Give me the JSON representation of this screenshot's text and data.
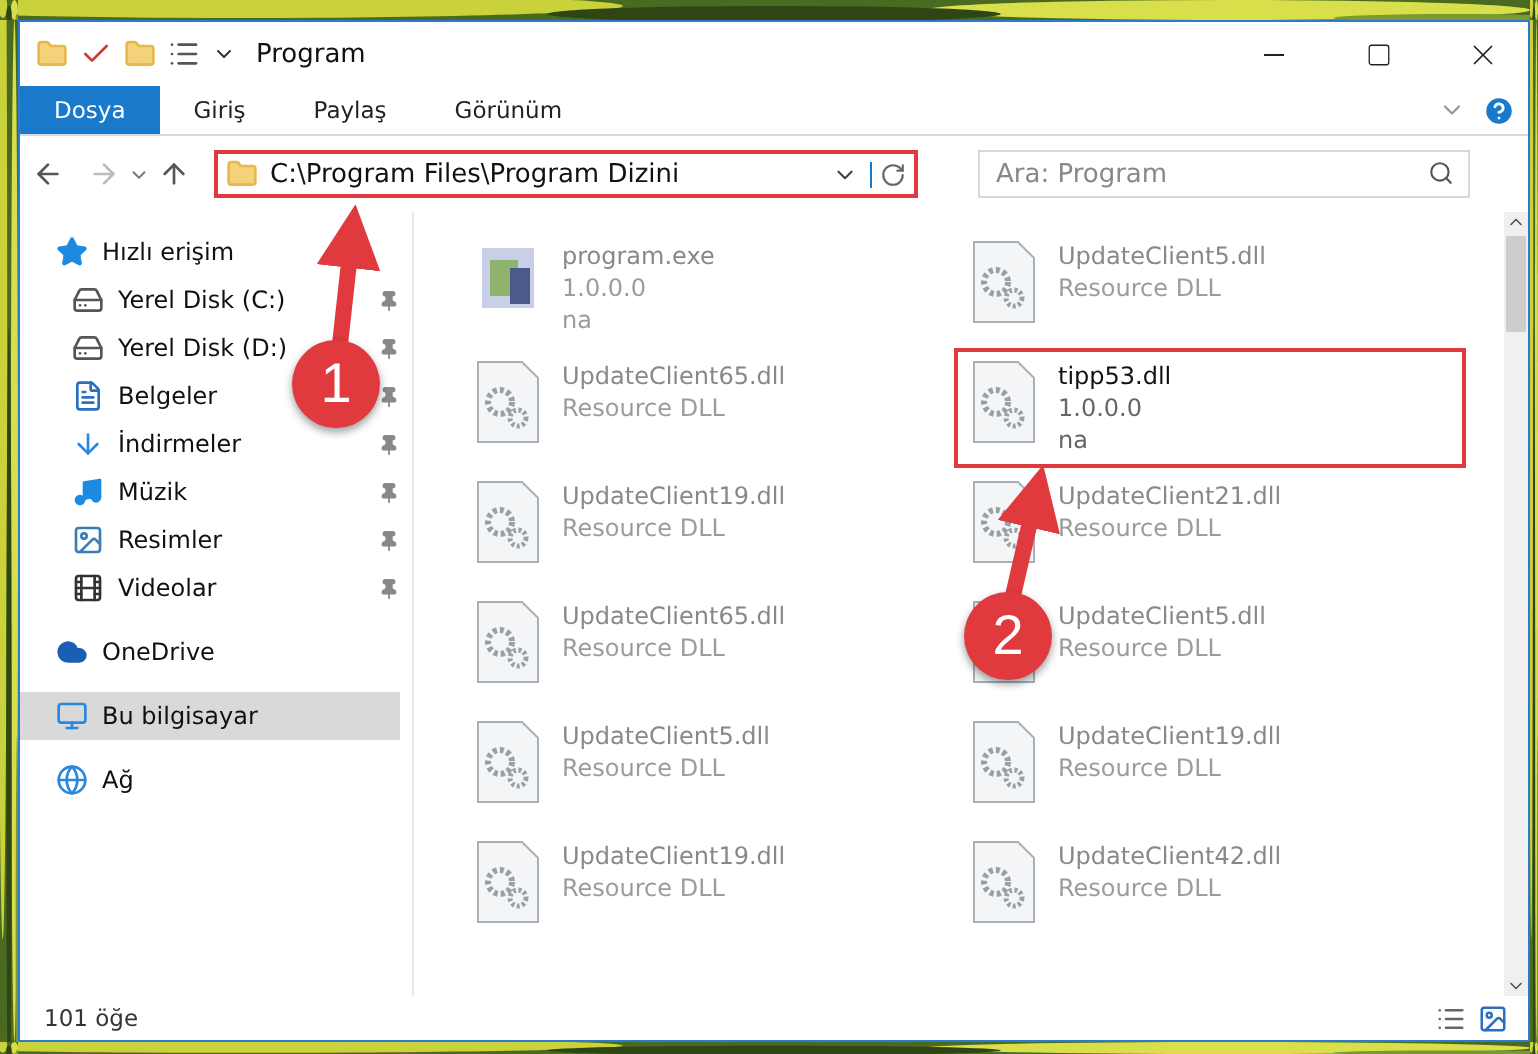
{
  "window": {
    "title": "Program"
  },
  "ribbon_tabs": [
    {
      "label": "Dosya",
      "selected": true
    },
    {
      "label": "Giriş",
      "selected": false
    },
    {
      "label": "Paylaş",
      "selected": false
    },
    {
      "label": "Görünüm",
      "selected": false
    }
  ],
  "address_bar": {
    "path": "C:\\Program Files\\Program Dizini",
    "highlighted": true
  },
  "search": {
    "placeholder": "Ara: Program"
  },
  "sidebar": {
    "items": [
      {
        "label": "Hızlı erişim",
        "kind": "star",
        "selected": false,
        "children": [
          {
            "label": "Yerel Disk (C:)",
            "kind": "drive",
            "selected": false,
            "pinned": true
          },
          {
            "label": "Yerel Disk (D:)",
            "kind": "drive",
            "selected": false,
            "pinned": true
          },
          {
            "label": "Belgeler",
            "kind": "docs",
            "selected": false,
            "pinned": true
          },
          {
            "label": "İndirmeler",
            "kind": "download",
            "selected": false,
            "pinned": true
          },
          {
            "label": "Müzik",
            "kind": "music",
            "selected": false,
            "pinned": true
          },
          {
            "label": "Resimler",
            "kind": "pictures",
            "selected": false,
            "pinned": true
          },
          {
            "label": "Videolar",
            "kind": "videos",
            "selected": false,
            "pinned": true
          }
        ]
      },
      {
        "label": "OneDrive",
        "kind": "cloud",
        "selected": false
      },
      {
        "label": "Bu bilgisayar",
        "kind": "computer",
        "selected": true
      },
      {
        "label": "Ağ",
        "kind": "network",
        "selected": false
      }
    ]
  },
  "files": [
    {
      "kind": "exe",
      "lines": [
        "program.exe",
        "1.0.0.0",
        "na"
      ],
      "blurred": true,
      "highlighted": false
    },
    {
      "kind": "dll",
      "lines": [
        "UpdateClient5.dll",
        "Resource DLL"
      ],
      "blurred": true,
      "highlighted": false
    },
    {
      "kind": "dll",
      "lines": [
        "UpdateClient65.dll",
        "Resource DLL"
      ],
      "blurred": true,
      "highlighted": false
    },
    {
      "kind": "dll",
      "lines": [
        "tipp53.dll",
        "1.0.0.0",
        "na"
      ],
      "blurred": false,
      "highlighted": true
    },
    {
      "kind": "dll",
      "lines": [
        "UpdateClient19.dll",
        "Resource DLL"
      ],
      "blurred": true,
      "highlighted": false
    },
    {
      "kind": "dll",
      "lines": [
        "UpdateClient21.dll",
        "Resource DLL"
      ],
      "blurred": true,
      "highlighted": false
    },
    {
      "kind": "dll",
      "lines": [
        "UpdateClient65.dll",
        "Resource DLL"
      ],
      "blurred": true,
      "highlighted": false
    },
    {
      "kind": "dll",
      "lines": [
        "UpdateClient5.dll",
        "Resource DLL"
      ],
      "blurred": true,
      "highlighted": false
    },
    {
      "kind": "dll",
      "lines": [
        "UpdateClient5.dll",
        "Resource DLL"
      ],
      "blurred": true,
      "highlighted": false
    },
    {
      "kind": "dll",
      "lines": [
        "UpdateClient19.dll",
        "Resource DLL"
      ],
      "blurred": true,
      "highlighted": false
    },
    {
      "kind": "dll",
      "lines": [
        "UpdateClient19.dll",
        "Resource DLL"
      ],
      "blurred": true,
      "highlighted": false
    },
    {
      "kind": "dll",
      "lines": [
        "UpdateClient42.dll",
        "Resource DLL"
      ],
      "blurred": true,
      "highlighted": false
    }
  ],
  "status_bar": {
    "count": "101 öğe"
  },
  "callouts": [
    {
      "label": "1"
    },
    {
      "label": "2"
    }
  ]
}
